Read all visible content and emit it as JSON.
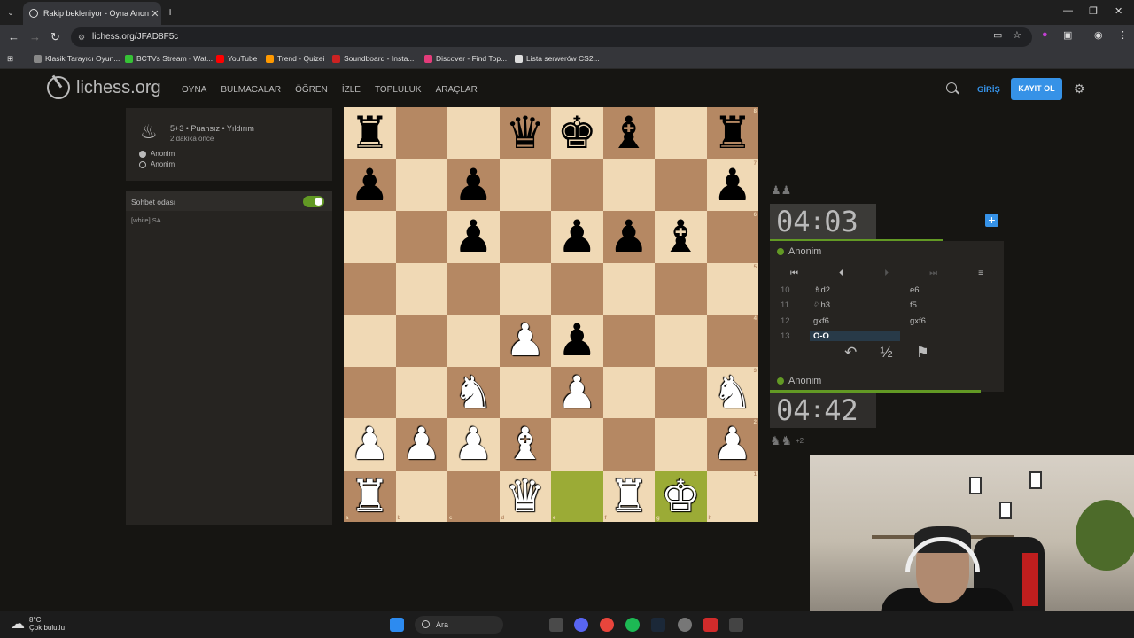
{
  "browser": {
    "tab_title": "Rakip bekleniyor - Oyna Anon...",
    "tab_close": "✕",
    "new_tab": "+",
    "url": "lichess.org/JFAD8F5c",
    "bookmarks": [
      {
        "label": "Klasik Tarayıcı Oyun...",
        "color": "#888888"
      },
      {
        "label": "BCTVs Stream - Wat...",
        "color": "#36c236"
      },
      {
        "label": "YouTube",
        "color": "#ff0000"
      },
      {
        "label": "Trend - Quizei",
        "color": "#ff9900"
      },
      {
        "label": "Soundboard - Insta...",
        "color": "#cc2222"
      },
      {
        "label": "Discover - Find Top...",
        "color": "#e33c7a"
      },
      {
        "label": "Lista serwerów CS2...",
        "color": "#dddddd"
      }
    ]
  },
  "site": {
    "logo": "lichess.org",
    "nav": [
      "OYNA",
      "BULMACALAR",
      "ÖĞREN",
      "İZLE",
      "TOPLULUK",
      "ARAÇLAR"
    ],
    "login": "GİRİŞ",
    "signup": "KAYIT OL"
  },
  "game_info": {
    "meta": "5+3 • Puansız • Yıldırım",
    "ago": "2 dakika önce",
    "white_player": "Anonim",
    "black_player": "Anonim"
  },
  "chat": {
    "title": "Sohbet odası",
    "message": "[white] SA"
  },
  "board": {
    "highlight_squares": [
      "e1",
      "g1"
    ],
    "rows": [
      [
        "r",
        "",
        "",
        "q",
        "k",
        "b",
        "",
        "r"
      ],
      [
        "p",
        "",
        "p",
        "",
        "",
        "",
        "",
        "p"
      ],
      [
        "",
        "",
        "p",
        "",
        "p",
        "p",
        "b",
        ""
      ],
      [
        "",
        "",
        "",
        "",
        "",
        "",
        "",
        ""
      ],
      [
        "",
        "",
        "",
        "P",
        "p",
        "",
        "",
        ""
      ],
      [
        "",
        "",
        "N",
        "",
        "P",
        "",
        "",
        "N"
      ],
      [
        "P",
        "P",
        "P",
        "B",
        "",
        "",
        "",
        "P"
      ],
      [
        "R",
        "",
        "",
        "Q",
        "",
        "R",
        "K",
        ""
      ]
    ],
    "ranks": [
      "8",
      "7",
      "6",
      "5",
      "4",
      "3",
      "2",
      "1"
    ],
    "files": [
      "a",
      "b",
      "c",
      "d",
      "e",
      "f",
      "g",
      "h"
    ]
  },
  "right_panel": {
    "top_clock_min": "04",
    "top_clock_sec": "03",
    "top_clock_fill": 0.74,
    "top_player": "Anonim",
    "bottom_clock_min": "04",
    "bottom_clock_sec": "42",
    "bottom_clock_fill": 0.9,
    "bottom_player": "Anonim",
    "material_diff": "+2",
    "moves": [
      {
        "n": "10",
        "w": "♗d2",
        "b": "e6"
      },
      {
        "n": "11",
        "w": "♘h3",
        "b": "f5"
      },
      {
        "n": "12",
        "w": "gxf6",
        "b": "gxf6"
      },
      {
        "n": "13",
        "w": "O-O",
        "b": ""
      }
    ],
    "draw_label": "½"
  },
  "taskbar": {
    "temp": "8°C",
    "weather": "Çok bulutlu",
    "search": "Ara"
  }
}
